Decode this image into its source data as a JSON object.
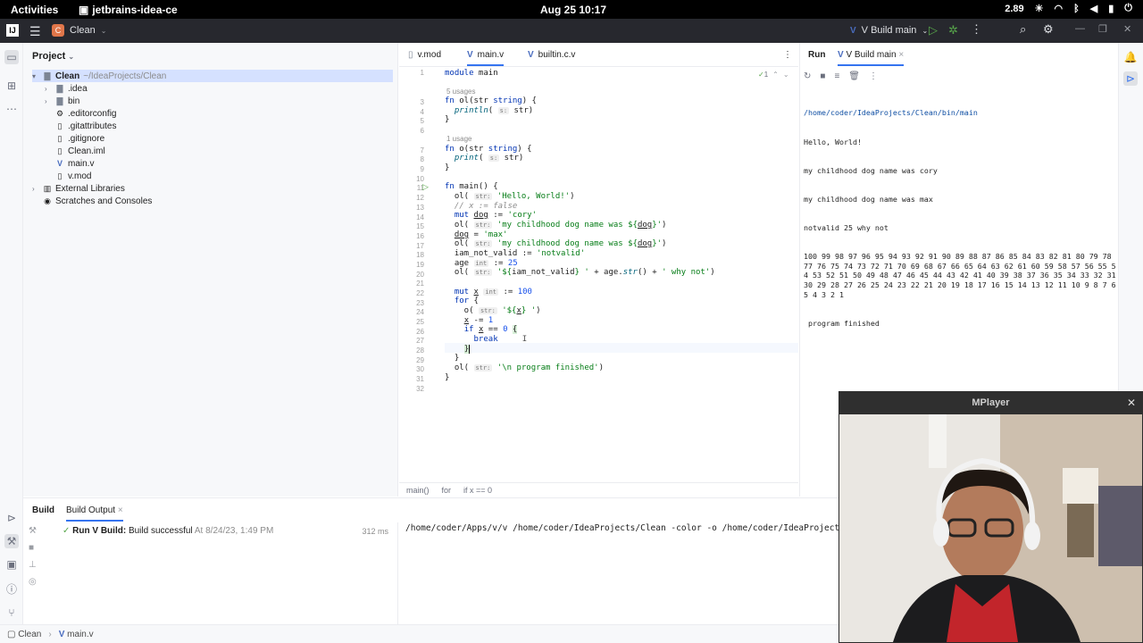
{
  "gnome": {
    "activities": "Activities",
    "app_name": "jetbrains-idea-ce",
    "clock": "Aug 25  10:17",
    "speed": "2.89"
  },
  "ide": {
    "project_badge": "C",
    "project_name": "Clean",
    "run_config": "V Build main"
  },
  "project_panel": {
    "title": "Project",
    "root": "Clean",
    "root_path": "~/IdeaProjects/Clean",
    "items": [
      ".idea",
      "bin",
      ".editorconfig",
      ".gitattributes",
      ".gitignore",
      "Clean.iml",
      "main.v",
      "v.mod"
    ],
    "external": "External Libraries",
    "scratches": "Scratches and Consoles"
  },
  "editor": {
    "tabs": [
      "v.mod",
      "main.v",
      "builtin.c.v"
    ],
    "inspection_count": "1",
    "usages_5": "5 usages",
    "usages_1": "1 usage",
    "breadcrumbs": [
      "main()",
      "for",
      "if x == 0"
    ]
  },
  "run": {
    "tab_run": "Run",
    "tab_config": "V Build main",
    "output_path": "/home/coder/IdeaProjects/Clean/bin/main",
    "output_lines": [
      "Hello, World!",
      "my childhood dog name was cory",
      "my childhood dog name was max",
      "notvalid 25 why not",
      "100 99 98 97 96 95 94 93 92 91 90 89 88 87 86 85 84 83 82 81 80 79 78 77 76 75 74 73 72 71 70 69 68 67 66 65 64 63 62 61 60 59 58 57 56 55 54 53 52 51 50 49 48 47 46 45 44 43 42 41 40 39 38 37 36 35 34 33 32 31 30 29 28 27 26 25 24 23 22 21 20 19 18 17 16 15 14 13 12 11 10 9 8 7 6 5 4 3 2 1",
      " program finished"
    ]
  },
  "build": {
    "tab_build": "Build",
    "tab_output": "Build Output",
    "result_title": "Run V Build:",
    "result_text": "Build successful",
    "result_time": "At 8/24/23, 1:49 PM",
    "duration": "312 ms",
    "command": "/home/coder/Apps/v/v /home/coder/IdeaProjects/Clean -color -o /home/coder/IdeaProjects/Clea"
  },
  "status": {
    "crumb1": "Clean",
    "crumb2": "main.v"
  },
  "mplayer": {
    "title": "MPlayer"
  }
}
